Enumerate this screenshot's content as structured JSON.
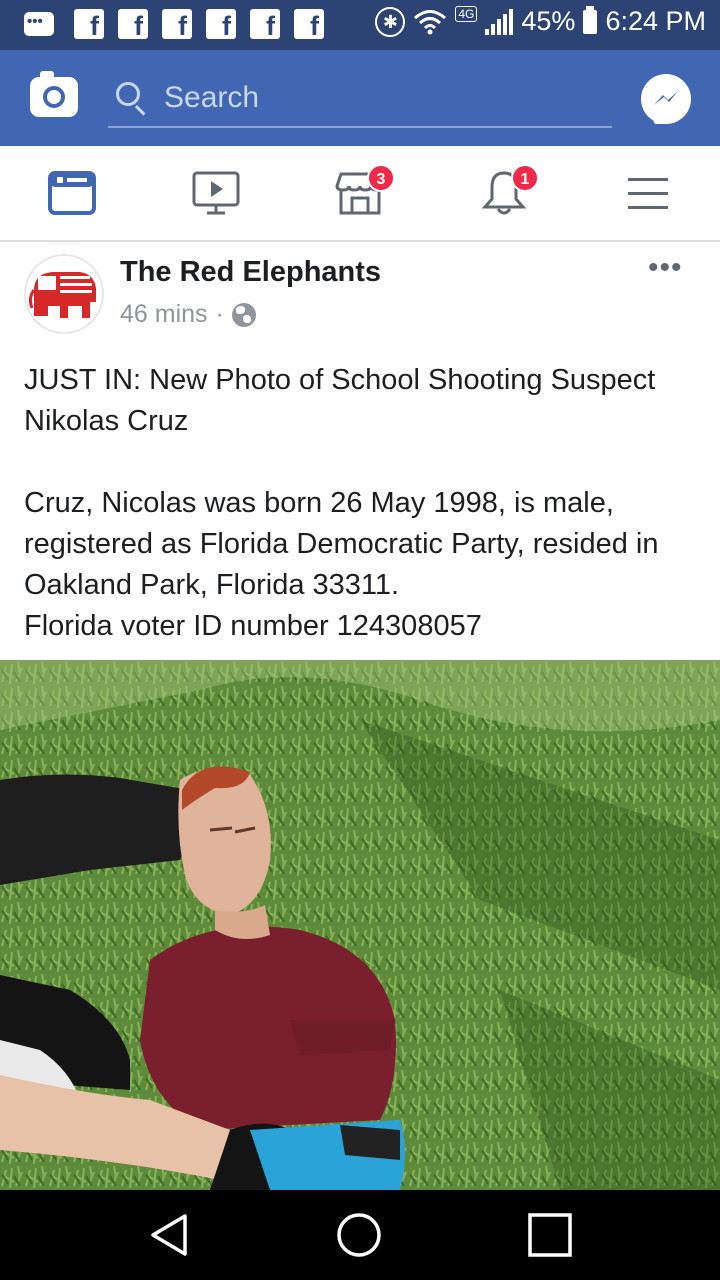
{
  "status_bar": {
    "notification_icons": [
      "chat-notification-icon",
      "facebook-notification-icon",
      "facebook-notification-icon",
      "facebook-notification-icon",
      "facebook-notification-icon",
      "facebook-notification-icon",
      "facebook-notification-icon"
    ],
    "network": "4G",
    "battery": "45%",
    "time": "6:24 PM"
  },
  "header": {
    "search_placeholder": "Search",
    "camera_icon": "camera-icon",
    "messenger_icon": "messenger-icon"
  },
  "nav_tabs": [
    {
      "name": "news-feed",
      "icon": "news-feed-icon",
      "active": true,
      "badge": ""
    },
    {
      "name": "watch",
      "icon": "watch-icon",
      "active": false,
      "badge": ""
    },
    {
      "name": "marketplace",
      "icon": "marketplace-icon",
      "active": false,
      "badge": "3"
    },
    {
      "name": "notifications",
      "icon": "bell-icon",
      "active": false,
      "badge": "1"
    },
    {
      "name": "menu",
      "icon": "hamburger-menu-icon",
      "active": false,
      "badge": ""
    }
  ],
  "post": {
    "author": "The Red Elephants",
    "time": "46 mins",
    "separator": "·",
    "privacy_icon": "globe-icon",
    "text_lines": [
      "JUST IN: New Photo of School Shooting Suspect Nikolas Cruz",
      "",
      "Cruz, Nicolas was born 26 May 1998, is male, registered as Florida Democratic Party, resided in Oakland Park, Florida 33311.",
      "Florida voter ID number 124308057"
    ],
    "more_label": "•••"
  },
  "colors": {
    "status_bar": "#2d4373",
    "header": "#4267b2",
    "active_tab": "#4267b2",
    "badge": "#f02849",
    "text": "#1c1e21",
    "meta": "#90949c"
  }
}
